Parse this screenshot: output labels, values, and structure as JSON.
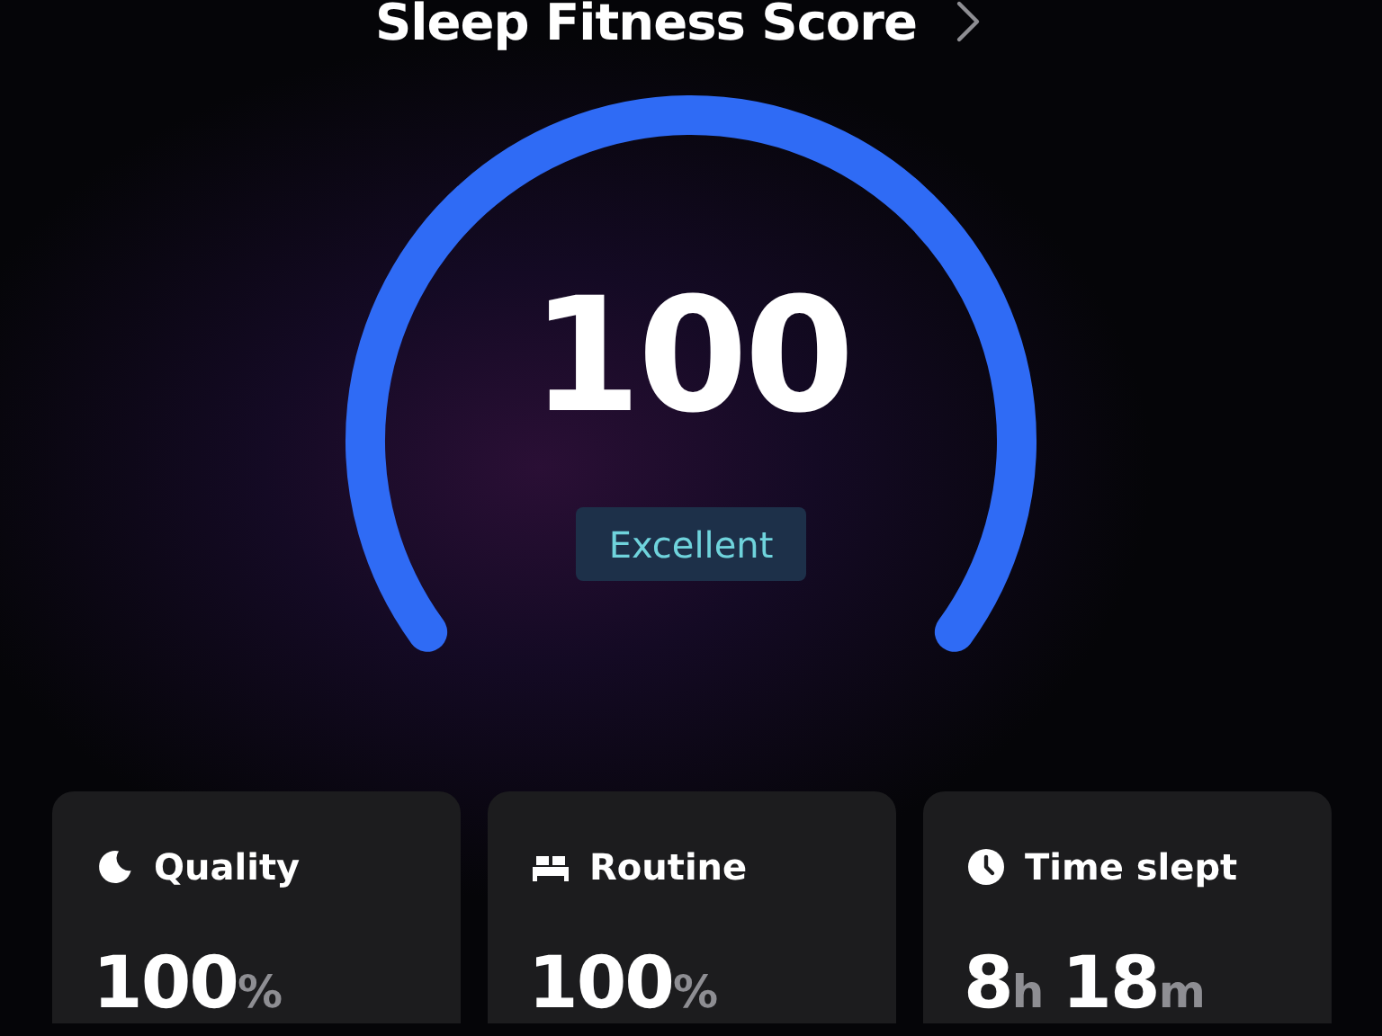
{
  "header": {
    "title": "Sleep Fitness Score"
  },
  "gauge": {
    "score": "100",
    "rating": "Excellent"
  },
  "cards": [
    {
      "title": "Quality",
      "value": [
        {
          "kind": "number",
          "text": "100"
        },
        {
          "kind": "unit",
          "text": "%"
        }
      ]
    },
    {
      "title": "Routine",
      "value": [
        {
          "kind": "number",
          "text": "100"
        },
        {
          "kind": "unit",
          "text": "%"
        }
      ]
    },
    {
      "title": "Time slept",
      "value": [
        {
          "kind": "number",
          "text": "8"
        },
        {
          "kind": "unit",
          "text": "h"
        },
        {
          "kind": "number",
          "text": "18"
        },
        {
          "kind": "unit",
          "text": "m"
        }
      ]
    }
  ]
}
